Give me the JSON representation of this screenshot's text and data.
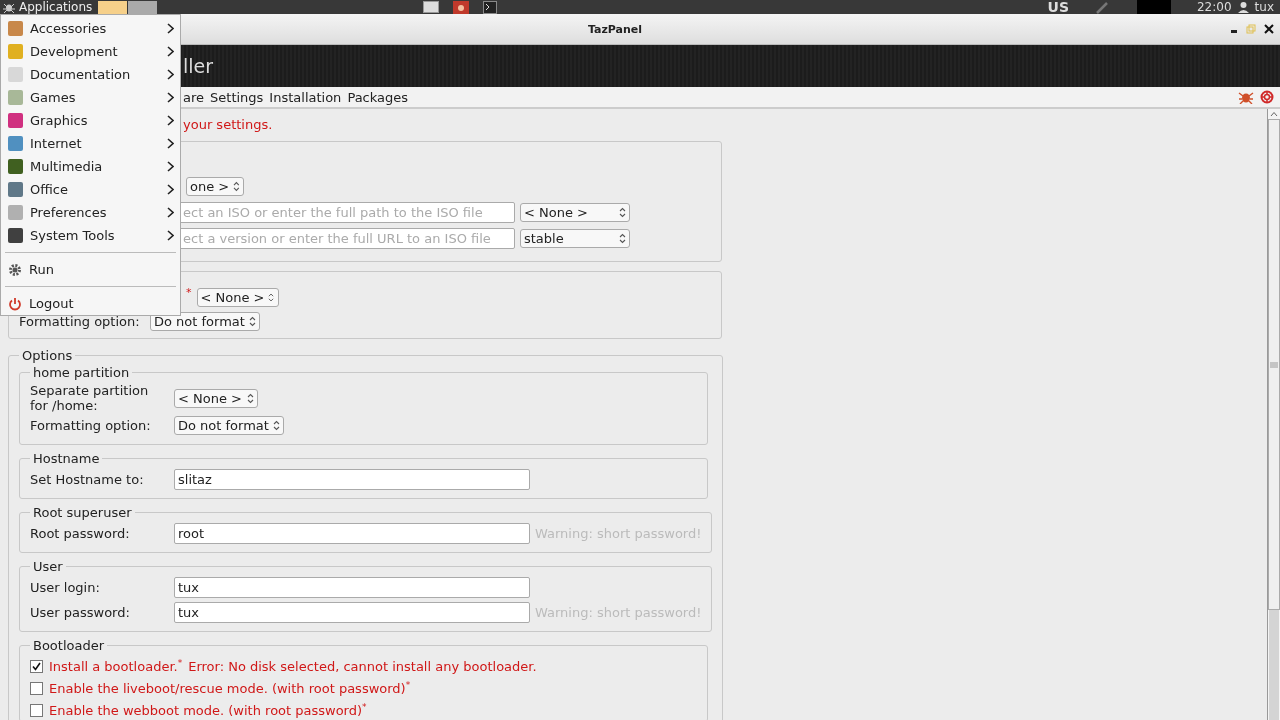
{
  "top_panel": {
    "menu_label": "Applications",
    "keyboard_layout": "US",
    "clock": "22:00",
    "user": "tux"
  },
  "app_menu": {
    "categories": [
      {
        "label": "Accessories",
        "color": "#c8884a"
      },
      {
        "label": "Development",
        "color": "#e0b020"
      },
      {
        "label": "Documentation",
        "color": "#d8d8d8"
      },
      {
        "label": "Games",
        "color": "#a8b898"
      },
      {
        "label": "Graphics",
        "color": "#d03080"
      },
      {
        "label": "Internet",
        "color": "#5090c0"
      },
      {
        "label": "Multimedia",
        "color": "#406020"
      },
      {
        "label": "Office",
        "color": "#607888"
      },
      {
        "label": "Preferences",
        "color": "#b0b0b0"
      },
      {
        "label": "System Tools",
        "color": "#404040"
      }
    ],
    "actions": [
      {
        "label": "Run",
        "kind": "run"
      },
      {
        "label": "Logout",
        "kind": "logout"
      }
    ]
  },
  "window": {
    "title": "TazPanel",
    "header_title": "ller",
    "menu": [
      "are",
      "Settings",
      "Installation",
      "Packages"
    ]
  },
  "notice": "your settings.",
  "source": {
    "type_select": "one >",
    "iso_placeholder": "ect an ISO or enter the full path to the ISO file",
    "iso_select": "< None >",
    "url_placeholder": "ect a version or enter the full URL to an ISO file",
    "version_select": "stable"
  },
  "target": {
    "required_mark": "*",
    "partition_select": "< None >",
    "format_label": "Formatting option:",
    "format_select": "Do not format"
  },
  "options": {
    "legend": "Options",
    "home_partition": {
      "legend": "home partition",
      "partition_label": "Separate partition for /home:",
      "partition_select": "< None >",
      "format_label": "Formatting option:",
      "format_select": "Do not format"
    },
    "hostname": {
      "legend": "Hostname",
      "label": "Set Hostname to:",
      "value": "slitaz"
    },
    "root": {
      "legend": "Root superuser",
      "label": "Root password:",
      "value": "root",
      "warning": "Warning: short password!"
    },
    "user": {
      "legend": "User",
      "login_label": "User login:",
      "login_value": "tux",
      "password_label": "User password:",
      "password_value": "tux",
      "warning": "Warning: short password!"
    },
    "bootloader": {
      "legend": "Bootloader",
      "items": [
        {
          "label": "Install a bootloader.",
          "mark": "*",
          "note": "Error: No disk selected, cannot install any bootloader.",
          "checked": true
        },
        {
          "label": "Enable the liveboot/rescue mode. (with root password)",
          "mark": "*",
          "checked": false
        },
        {
          "label": "Enable the webboot mode. (with root password)",
          "mark": "*",
          "checked": false
        }
      ]
    }
  }
}
